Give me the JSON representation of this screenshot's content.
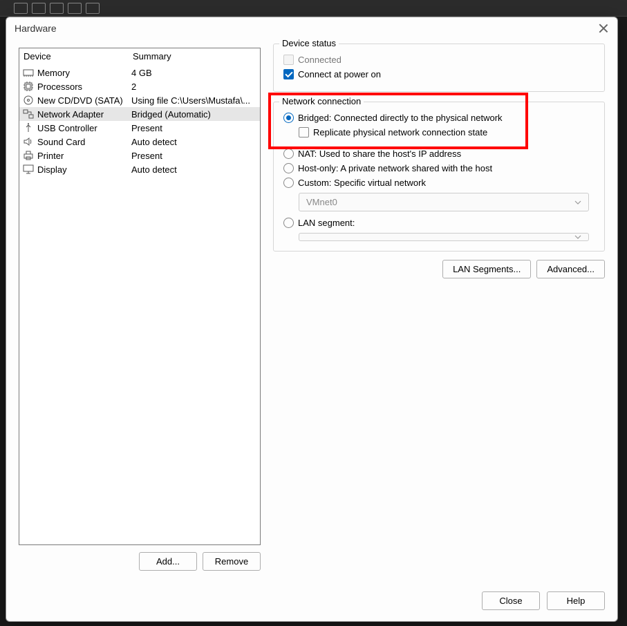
{
  "toolbar": {
    "icons": [
      "layout",
      "tabs",
      "pin",
      "camera",
      "terminal"
    ]
  },
  "dialog": {
    "title": "Hardware",
    "close_button": "Close"
  },
  "deviceList": {
    "headers": {
      "device": "Device",
      "summary": "Summary"
    },
    "items": [
      {
        "icon": "memory",
        "name": "Memory",
        "summary": "4 GB"
      },
      {
        "icon": "cpu",
        "name": "Processors",
        "summary": "2"
      },
      {
        "icon": "disc",
        "name": "New CD/DVD (SATA)",
        "summary": "Using file C:\\Users\\Mustafa\\..."
      },
      {
        "icon": "network",
        "name": "Network Adapter",
        "summary": "Bridged (Automatic)",
        "selected": true
      },
      {
        "icon": "usb",
        "name": "USB Controller",
        "summary": "Present"
      },
      {
        "icon": "sound",
        "name": "Sound Card",
        "summary": "Auto detect"
      },
      {
        "icon": "printer",
        "name": "Printer",
        "summary": "Present"
      },
      {
        "icon": "display",
        "name": "Display",
        "summary": "Auto detect"
      }
    ],
    "add_button": "Add...",
    "remove_button": "Remove"
  },
  "deviceStatus": {
    "legend": "Device status",
    "connected_label": "Connected",
    "connected_checked": false,
    "connected_enabled": false,
    "connect_at_power_on_label": "Connect at power on",
    "connect_at_power_on_checked": true
  },
  "networkConnection": {
    "legend": "Network connection",
    "bridged_label": "Bridged: Connected directly to the physical network",
    "replicate_label": "Replicate physical network connection state",
    "replicate_checked": false,
    "nat_label": "NAT: Used to share the host's IP address",
    "hostonly_label": "Host-only: A private network shared with the host",
    "custom_label": "Custom: Specific virtual network",
    "custom_select_value": "VMnet0",
    "lan_segment_label": "LAN segment:",
    "lan_select_value": "",
    "selected": "bridged"
  },
  "rightButtons": {
    "lan_segments": "LAN Segments...",
    "advanced": "Advanced..."
  },
  "footer": {
    "close": "Close",
    "help": "Help"
  }
}
